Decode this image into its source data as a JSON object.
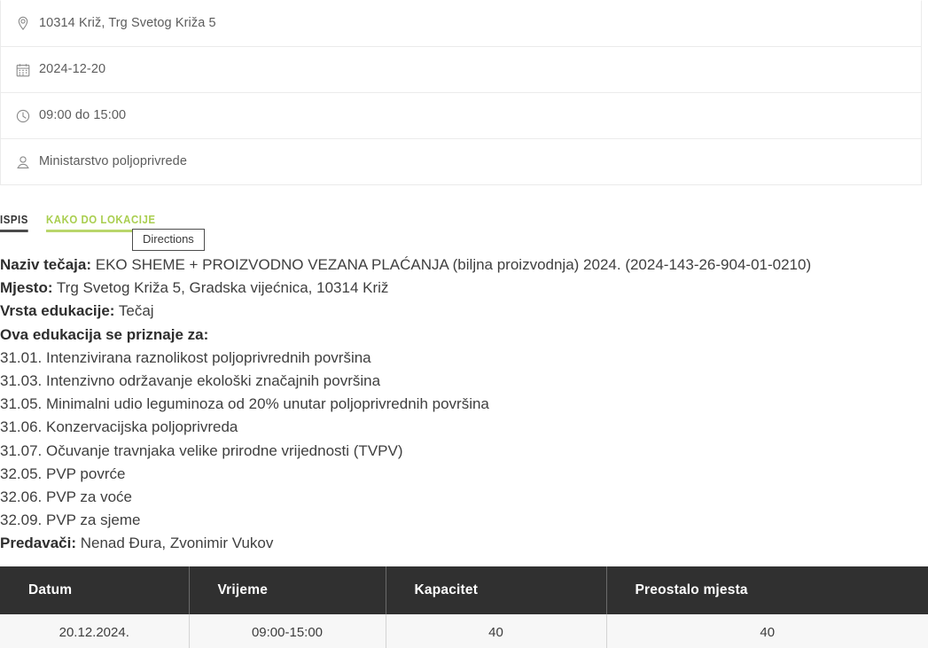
{
  "info_list": [
    {
      "icon": "map-pin-icon",
      "name": "location",
      "text": "10314 Križ, Trg Svetog Križa 5"
    },
    {
      "icon": "calendar-icon",
      "name": "date",
      "text": "2024-12-20"
    },
    {
      "icon": "clock-icon",
      "name": "time",
      "text": "09:00 do 15:00"
    },
    {
      "icon": "user-icon",
      "name": "organizer",
      "text": "Ministarstvo poljoprivrede"
    }
  ],
  "actions": {
    "print_label": "ISPIS",
    "directions_label": "KAKO DO LOKACIJE"
  },
  "tooltip": {
    "text": "Directions"
  },
  "details": {
    "course_label": "Naziv tečaja:",
    "course_value": "EKO SHEME + PROIZVODNO VEZANA PLAĆANJA (biljna proizvodnja) 2024. (2024-143-26-904-01-0210)",
    "place_label": "Mjesto:",
    "place_value": "Trg Svetog Križa 5, Gradska vijećnica, 10314 Križ",
    "type_label": "Vrsta edukacije:",
    "type_value": "Tečaj",
    "recognized_heading": "Ova edukacija se priznaje za:",
    "recognized_items": [
      "31.01. Intenzivirana raznolikost poljoprivrednih površina",
      "31.03. Intenzivno održavanje ekološki značajnih površina",
      "31.05. Minimalni udio leguminoza od 20% unutar poljoprivrednih površina",
      "31.06. Konzervacijska poljoprivreda",
      "31.07. Očuvanje travnjaka velike prirodne vrijednosti (TVPV)",
      "32.05. PVP povrće",
      "32.06. PVP za voće",
      "32.09. PVP za sjeme"
    ],
    "lecturers_label": "Predavači:",
    "lecturers_value": "Nenad Đura, Zvonimir Vukov"
  },
  "schedule_table": {
    "headers": [
      "Datum",
      "Vrijeme",
      "Kapacitet",
      "Preostalo mjesta"
    ],
    "rows": [
      [
        "20.12.2024.",
        "09:00-15:00",
        "40",
        "40"
      ]
    ]
  },
  "colors": {
    "accent_green": "#a9ce4f",
    "table_header_bg": "#303030",
    "divider": "#ebebeb"
  }
}
